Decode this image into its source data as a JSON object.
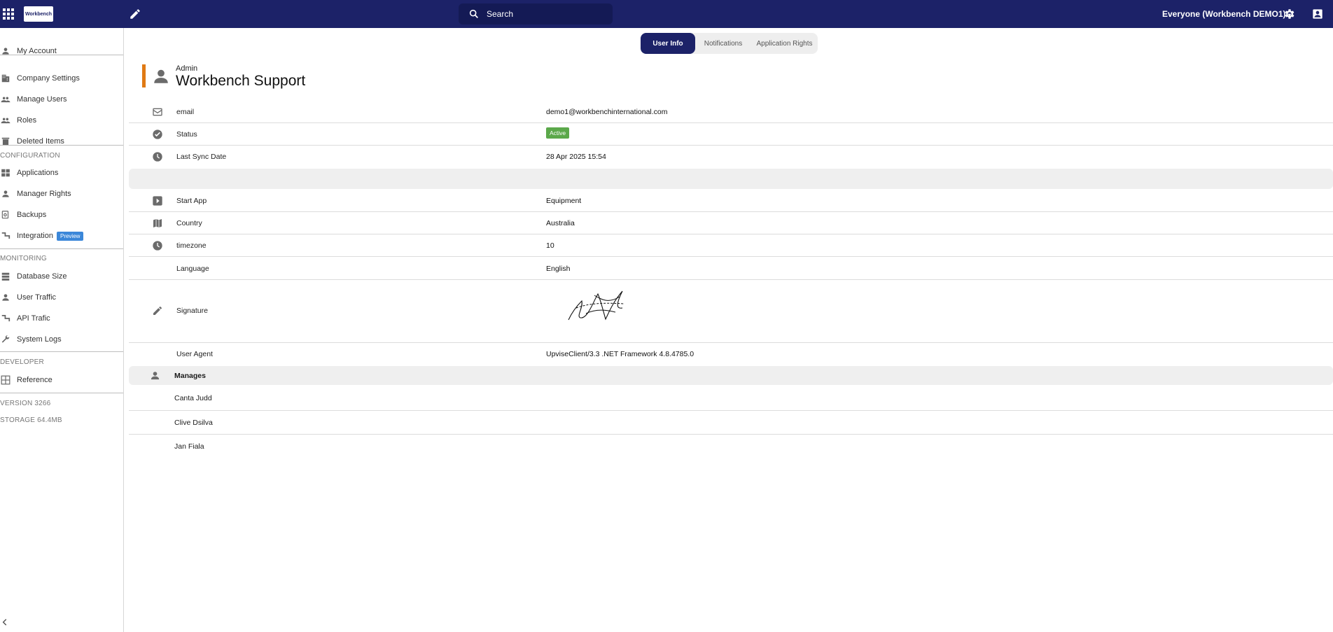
{
  "topbar": {
    "logo_text": "Workbench",
    "search_placeholder": "Search",
    "group_label": "Everyone (Workbench DEMO1)",
    "colors": {
      "bar": "#1c2268",
      "search": "#141a55"
    }
  },
  "sidebar": {
    "items_top": [
      {
        "label": "My Account",
        "icon": "person-icon"
      },
      {
        "label": "Company Settings",
        "icon": "building-icon"
      },
      {
        "label": "Manage Users",
        "icon": "people-icon"
      },
      {
        "label": "Roles",
        "icon": "people-icon"
      },
      {
        "label": "Deleted Items",
        "icon": "trash-icon"
      }
    ],
    "configuration_heading": "CONFIGURATION",
    "configuration_items": [
      {
        "label": "Applications",
        "icon": "windows-icon"
      },
      {
        "label": "Manager Rights",
        "icon": "person-icon"
      },
      {
        "label": "Backups",
        "icon": "backup-icon"
      },
      {
        "label": "Integration",
        "icon": "route-icon",
        "badge": "Preview"
      }
    ],
    "monitoring_heading": "MONITORING",
    "monitoring_items": [
      {
        "label": "Database Size",
        "icon": "database-icon"
      },
      {
        "label": "User Traffic",
        "icon": "person-icon"
      },
      {
        "label": "API Trafic",
        "icon": "route-icon"
      },
      {
        "label": "System Logs",
        "icon": "wrench-icon"
      }
    ],
    "developer_heading": "DEVELOPER",
    "developer_items": [
      {
        "label": "Reference",
        "icon": "grid-icon"
      }
    ],
    "version": "VERSION 3266",
    "storage": "STORAGE 64.4MB"
  },
  "tabs": [
    {
      "label": "User Info",
      "active": true
    },
    {
      "label": "Notifications",
      "active": false
    },
    {
      "label": "Application Rights",
      "active": false
    }
  ],
  "user": {
    "role": "Admin",
    "name": "Workbench Support",
    "accent_color": "#e07a14"
  },
  "details": [
    {
      "label": "email",
      "value": "demo1@workbenchinternational.com",
      "icon": "mail-icon"
    },
    {
      "label": "Status",
      "value": "Active",
      "icon": "check-circle-icon",
      "badge_color": "#5ba84a"
    },
    {
      "label": "Last Sync Date",
      "value": "28 Apr 2025 15:54",
      "icon": "clock-icon"
    },
    {
      "label": "Start App",
      "value": "Equipment",
      "icon": "play-icon"
    },
    {
      "label": "Country",
      "value": "Australia",
      "icon": "map-icon"
    },
    {
      "label": "timezone",
      "value": "10",
      "icon": "clock-icon"
    },
    {
      "label": "Language",
      "value": "English"
    },
    {
      "label": "Signature",
      "icon": "pencil-icon"
    },
    {
      "label": "User Agent",
      "value": "UpviseClient/3.3 .NET Framework 4.8.4785.0"
    }
  ],
  "manages": {
    "heading": "Manages",
    "icon": "person-icon",
    "people": [
      "Canta Judd",
      "Clive Dsilva",
      "Jan Fiala"
    ]
  }
}
